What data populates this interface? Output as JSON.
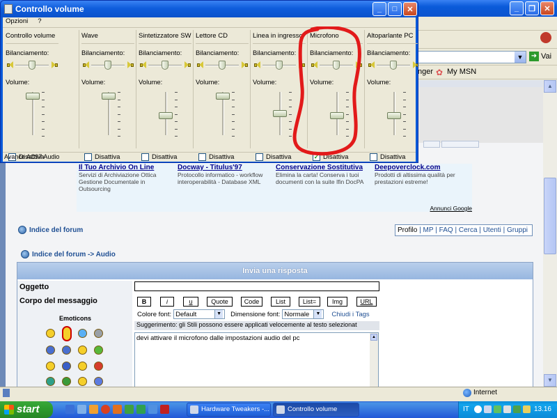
{
  "volume_window": {
    "title": "Controllo volume",
    "menu": [
      "Opzioni",
      "?"
    ],
    "footer": "Avance AC97 Audio",
    "balance_label": "Bilanciamento:",
    "volume_label": "Volume:",
    "mute_label": "Disattiva",
    "channels": [
      {
        "name": "Controllo volume",
        "balance": 0.5,
        "volume": 0.95,
        "muted": false
      },
      {
        "name": "Wave",
        "balance": 0.5,
        "volume": 0.95,
        "muted": false
      },
      {
        "name": "Sintetizzatore SW",
        "balance": 0.5,
        "volume": 0.5,
        "muted": false
      },
      {
        "name": "Lettore CD",
        "balance": 0.5,
        "volume": 0.95,
        "muted": false
      },
      {
        "name": "Linea in ingresso",
        "balance": 0.5,
        "volume": 0.55,
        "muted": false
      },
      {
        "name": "Microfono",
        "balance": 0.5,
        "volume": 0.5,
        "muted": true
      },
      {
        "name": "Altoparlante PC",
        "balance": 0.5,
        "volume": 0.5,
        "muted": false
      }
    ]
  },
  "browser": {
    "go_label": "Vai",
    "links_partial": "nger",
    "my_msn": "My MSN",
    "status": "Internet"
  },
  "ads": [
    {
      "title": "Il Tuo Archivio On Line",
      "desc": "Servizi di Archiviazione Ottica Gestione Documentale in Outsourcing"
    },
    {
      "title": "Docway - Titulus'97",
      "desc": "Protocollo informatico - workflow interoperabilità - Database XML"
    },
    {
      "title": "Conservazione Sostitutiva",
      "desc": "Elimina la carta! Conserva i tuoi documenti con la suite Ifin DocPA"
    },
    {
      "title": "Deepoverclock.com",
      "desc": "Prodotti di altissima qualità per prestazioni estreme!"
    }
  ],
  "ads_footer": "Annunci Google",
  "forum": {
    "index_link": "Indice del forum",
    "breadcrumb": "Indice del forum -> Audio",
    "nav": [
      "Profilo",
      "MP",
      "FAQ",
      "Cerca",
      "Utenti",
      "Gruppi"
    ],
    "nav_sep": " | ",
    "post_header": "Invia una risposta",
    "subject_label": "Oggetto",
    "body_label": "Corpo del messaggio",
    "emoticons_label": "Emoticons",
    "format_buttons": [
      "B",
      "i",
      "u",
      "Quote",
      "Code",
      "List",
      "List=",
      "Img",
      "URL"
    ],
    "font_color_label": "Colore font:",
    "font_color_value": "Default",
    "font_size_label": "Dimensione font:",
    "font_size_value": "Normale",
    "close_tags": "Chiudi i Tags",
    "hint": "Suggerimento: gli Stili possono essere applicati velocemente al testo selezionat",
    "message": "devi attivare il microfono dalle impostazioni audio del pc"
  },
  "taskbar": {
    "start": "start",
    "tasks": [
      "Hardware Tweakers -...",
      "Controllo volume"
    ],
    "lang": "IT",
    "clock": "13.16"
  },
  "colors": {
    "annotation": "#e21a1a",
    "titlebar": "#0a5ad9",
    "start": "#2e9c2e"
  }
}
